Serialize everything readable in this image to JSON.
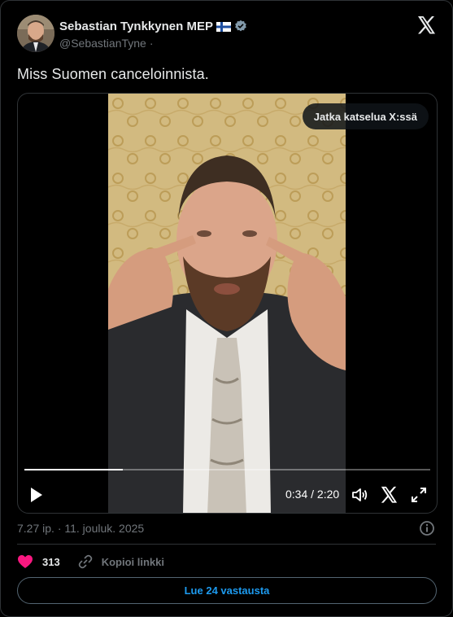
{
  "author": {
    "name": "Sebastian Tynkkynen MEP",
    "handle": "@SebastianTyne",
    "handle_sep": "·",
    "flag": "finland-flag-icon",
    "verified": "verified-badge-icon"
  },
  "tweet": {
    "text": "Miss Suomen canceloinnista."
  },
  "video": {
    "continue_label": "Jatka katselua X:ssä",
    "time": "0:34 / 2:20",
    "progress_fraction": 0.243,
    "icons": [
      "play-icon",
      "volume-icon",
      "x-logo-icon",
      "fullscreen-icon"
    ]
  },
  "meta": {
    "timestamp": "7.27 ip. · 11. jouluk. 2025"
  },
  "actions": {
    "likes": "313",
    "copy_link": "Kopioi linkki"
  },
  "replies_button": "Lue 24 vastausta",
  "colors": {
    "background": "#000000",
    "text": "#e7e9ea",
    "secondary": "#71767b",
    "accent": "#1d9bf0",
    "like": "#f91880",
    "border": "#2f3336"
  }
}
